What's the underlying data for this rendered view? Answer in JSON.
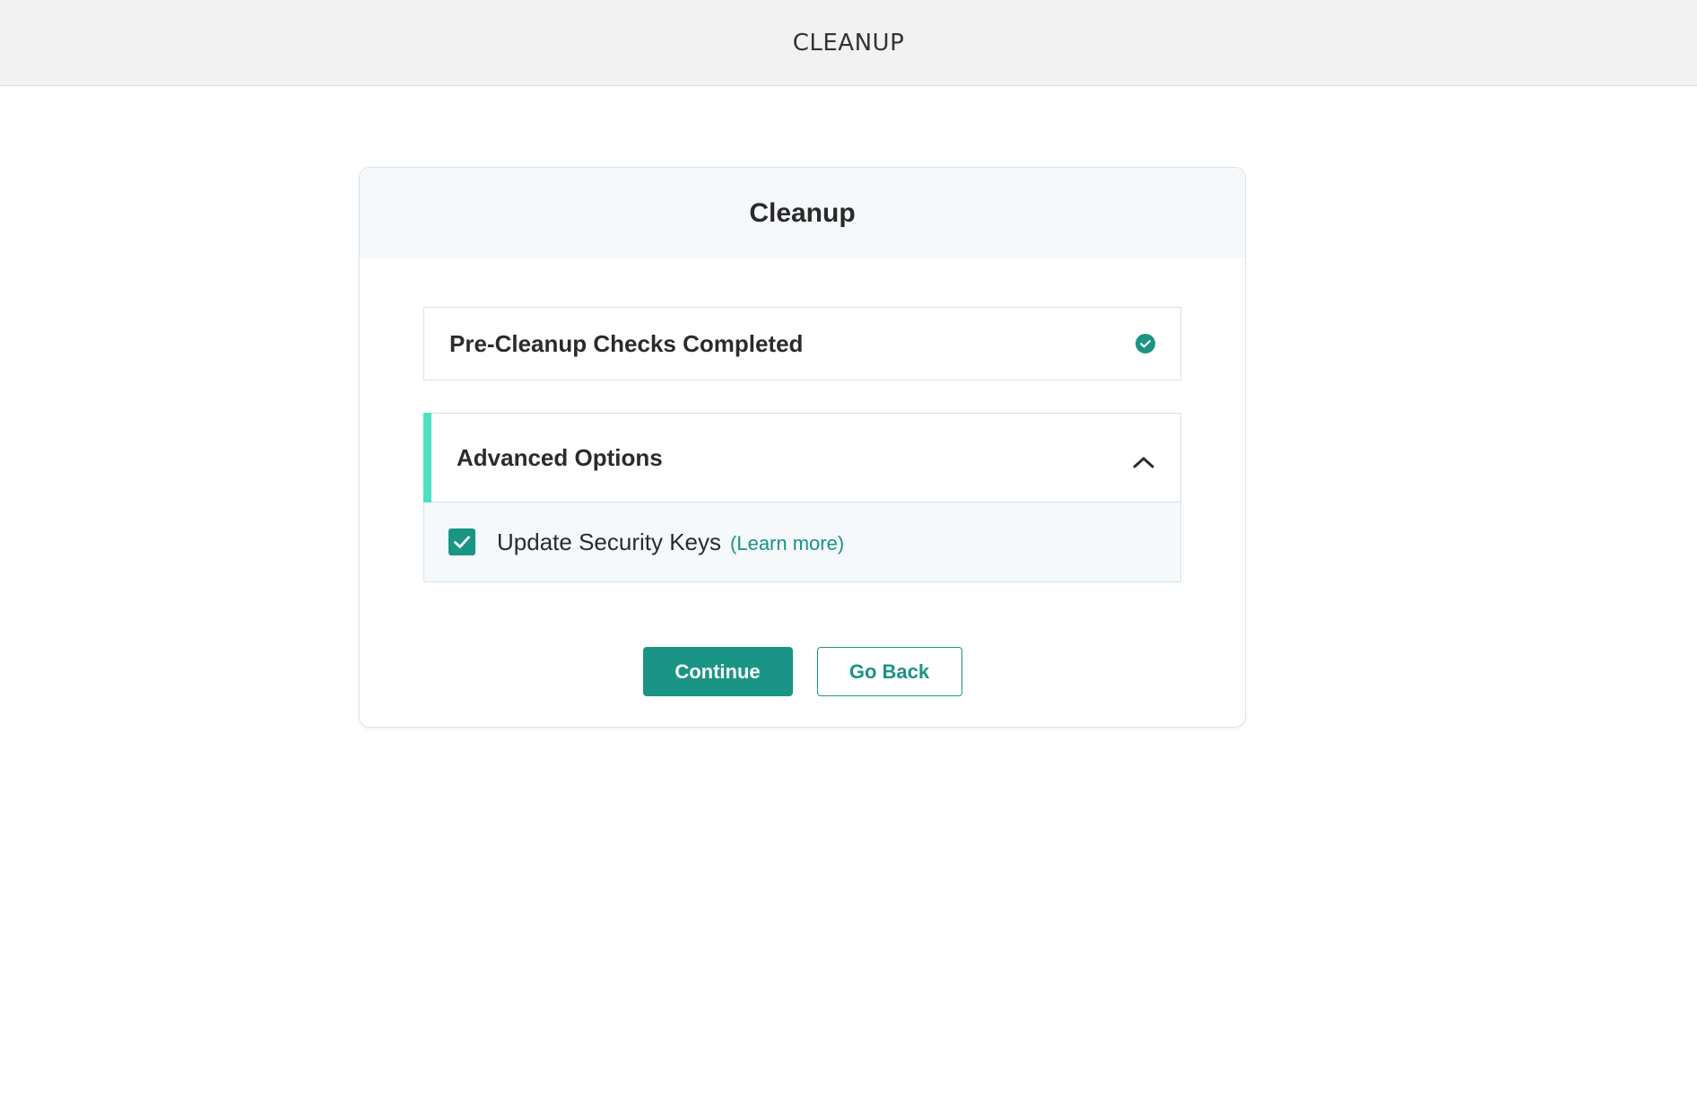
{
  "topbar": {
    "title": "CLEANUP"
  },
  "card": {
    "title": "Cleanup",
    "checks": {
      "label": "Pre-Cleanup Checks Completed",
      "status_icon": "check-circle-icon",
      "status_color": "#1a9484"
    },
    "advanced": {
      "label": "Advanced Options",
      "expanded": true,
      "toggle_icon": "chevron-up-icon",
      "accent_color": "#4ee0c1",
      "options": [
        {
          "label": "Update Security Keys",
          "checked": true,
          "link_text": "(Learn more)"
        }
      ]
    },
    "actions": {
      "continue_label": "Continue",
      "go_back_label": "Go Back"
    }
  },
  "colors": {
    "primary": "#1a9484",
    "accent": "#4ee0c1",
    "topbar_bg": "#f2f2f2",
    "panel_bg": "#f5f9fc"
  }
}
